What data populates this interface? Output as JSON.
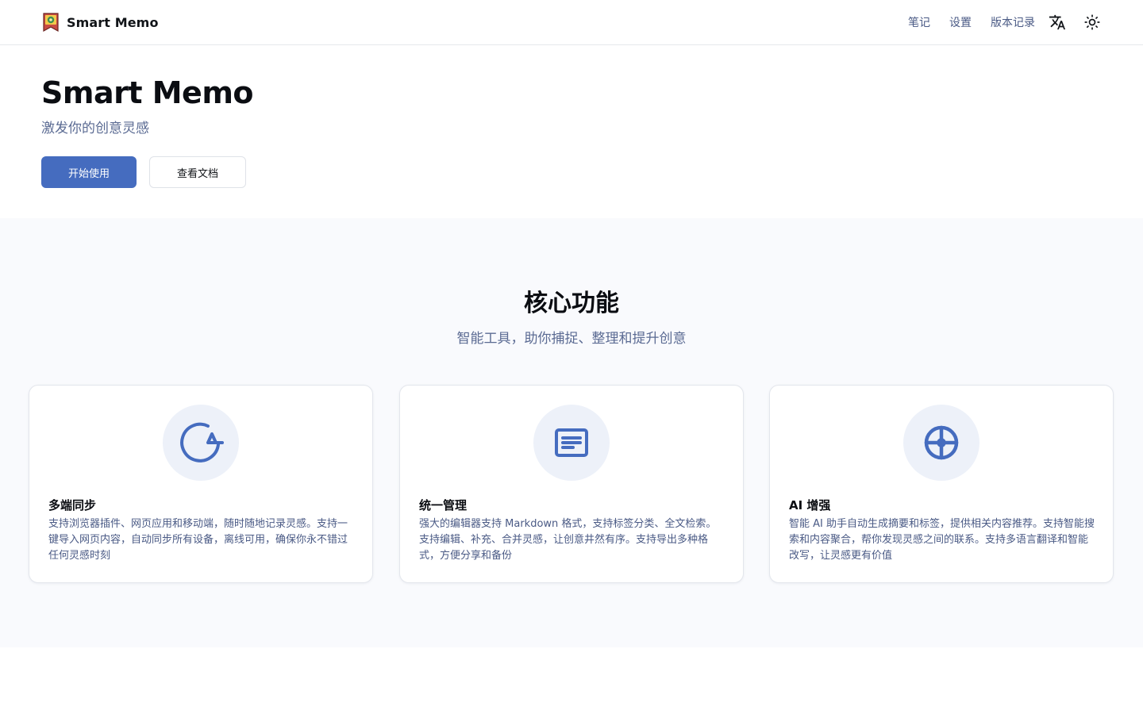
{
  "header": {
    "brand_name": "Smart Memo",
    "nav": {
      "notes": "笔记",
      "settings": "设置",
      "changelog": "版本记录"
    },
    "icons": {
      "logo": "memo-logo-icon",
      "language": "translate-icon",
      "theme": "sun-icon"
    }
  },
  "hero": {
    "title": "Smart Memo",
    "subtitle": "激发你的创意灵感",
    "primary_button": "开始使用",
    "secondary_button": "查看文档"
  },
  "features": {
    "title": "核心功能",
    "subtitle": "智能工具，助你捕捉、整理和提升创意",
    "cards": [
      {
        "icon": "sync-icon",
        "title": "多端同步",
        "desc": "支持浏览器插件、网页应用和移动端，随时随地记录灵感。支持一键导入网页内容，自动同步所有设备，离线可用，确保你永不错过任何灵感时刻"
      },
      {
        "icon": "note-icon",
        "title": "统一管理",
        "desc": "强大的编辑器支持 Markdown 格式，支持标签分类、全文检索。支持编辑、补充、合并灵感，让创意井然有序。支持导出多种格式，方便分享和备份"
      },
      {
        "icon": "crosshair-icon",
        "title": "AI 增强",
        "desc": "智能 AI 助手自动生成摘要和标签，提供相关内容推荐。支持智能搜索和内容聚合，帮你发现灵感之间的联系。支持多语言翻译和智能改写，让灵感更有价值"
      }
    ]
  },
  "colors": {
    "accent": "#456cbf",
    "icon_bg": "#edf1f9",
    "muted_text": "#5b6b93",
    "section_bg": "#f9fafd"
  }
}
